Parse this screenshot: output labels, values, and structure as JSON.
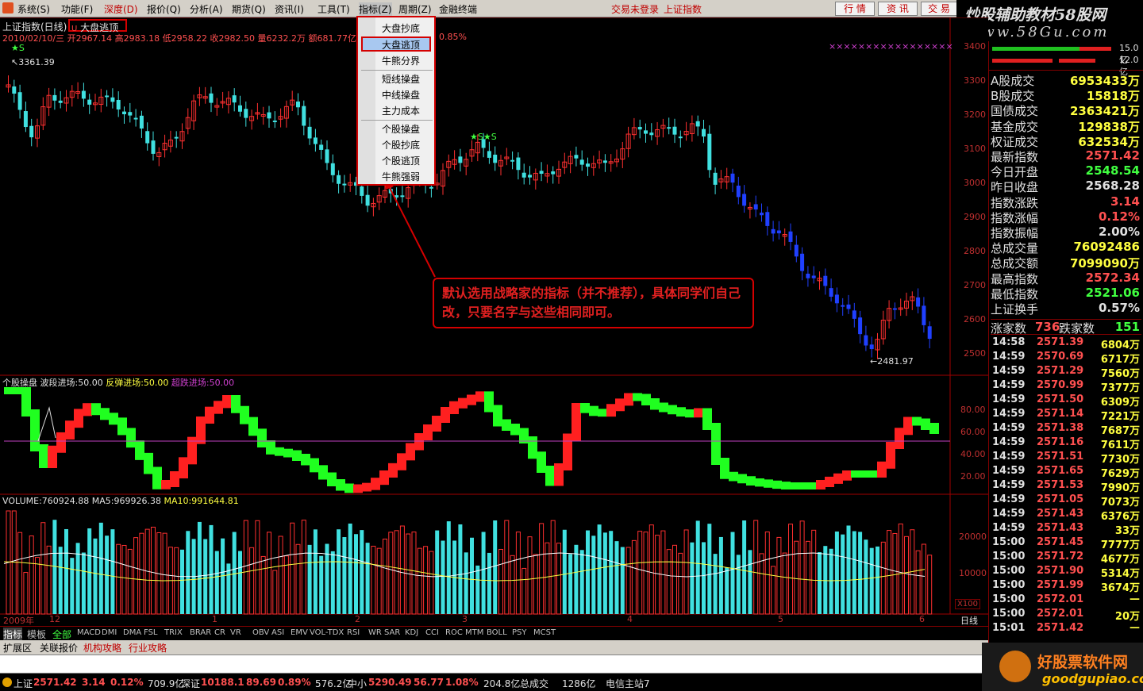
{
  "menu": {
    "items": [
      "系统(S)",
      "功能(F)",
      "深度(D)",
      "报价(Q)",
      "分析(A)",
      "期货(Q)",
      "资讯(I)",
      "工具(T)",
      "指标(Z)",
      "周期(Z)",
      "金融终端"
    ],
    "status": "交易未登录",
    "index_name": "上证指数",
    "right_buttons": [
      "行 情",
      "资 讯",
      "交 易"
    ]
  },
  "banner": {
    "title": "炒股辅助教材58股网",
    "url": "www.58Gu.com"
  },
  "dropdown": {
    "items": [
      "大盘抄底",
      "大盘逃顶",
      "牛熊分界",
      "短线操盘",
      "中线操盘",
      "主力成本",
      "个股操盘",
      "个股抄底",
      "个股逃顶",
      "牛熊强弱"
    ],
    "selected": "大盘逃顶"
  },
  "chart_header": {
    "title": "上证指数(日线)",
    "indicator": "大盘逃顶",
    "ohlc": "2010/02/10/三 开2967.14 高2983.18 低2958.22 收2982.50 量6232.2万 额681.77亿",
    "pct": "0.85%"
  },
  "annotation": "默认选用战略家的指标（并不推荐），具体同学们自己改，只要名字与这些相同即可。",
  "price_axis": [
    "3400",
    "3300",
    "3200",
    "3100",
    "3000",
    "2900",
    "2800",
    "2700",
    "2600",
    "2500"
  ],
  "price_marks": {
    "high": "3361.39",
    "low": "2481.97",
    "star1": "S",
    "star2": "S",
    "star3": "S"
  },
  "osc_header": {
    "name": "个股操盘",
    "a": "波段进场:50.00",
    "b": "反弹进场:50.00",
    "c": "超跌进场:50.00"
  },
  "osc_axis": [
    "80.00",
    "60.00",
    "40.00",
    "20.00"
  ],
  "vol_header": {
    "vol": "VOLUME:760924.88",
    "ma5": "MA5:969926.38",
    "ma10": "MA10:991644.81"
  },
  "vol_axis": [
    "20000",
    "10000"
  ],
  "vol_unit": "X100",
  "date_axis": {
    "year": "2009年",
    "labels": [
      "12",
      "1",
      "2",
      "3",
      "4",
      "5",
      "6"
    ],
    "right": "日线"
  },
  "tabs": [
    "指标",
    "模板",
    "全部",
    "MACD",
    "DMI",
    "DMA",
    "FSL",
    "TRIX",
    "BRAR",
    "CR",
    "VR",
    "OBV",
    "ASI",
    "EMV",
    "VOL-TDX",
    "RSI",
    "WR",
    "SAR",
    "KDJ",
    "CCI",
    "ROC",
    "MTM",
    "BOLL",
    "PSY",
    "MCST"
  ],
  "ext_tabs": [
    "扩展区",
    "关联报价",
    "机构攻略",
    "行业攻略"
  ],
  "right_panel": {
    "bar1": "15.0亿",
    "bar2": "12.0亿",
    "rows": [
      {
        "label": "A股成交",
        "value": "6953433万"
      },
      {
        "label": "B股成交",
        "value": "15818万"
      },
      {
        "label": "国债成交",
        "value": "2363421万"
      },
      {
        "label": "基金成交",
        "value": "129838万"
      },
      {
        "label": "权证成交",
        "value": "632534万"
      },
      {
        "label": "最新指数",
        "value": "2571.42"
      },
      {
        "label": "今日开盘",
        "value": "2548.54"
      },
      {
        "label": "昨日收盘",
        "value": "2568.28"
      },
      {
        "label": "指数涨跌",
        "value": "3.14"
      },
      {
        "label": "指数涨幅",
        "value": "0.12%"
      },
      {
        "label": "指数振幅",
        "value": "2.00%"
      },
      {
        "label": "总成交量",
        "value": "76092486"
      },
      {
        "label": "总成交额",
        "value": "7099090万"
      },
      {
        "label": "最高指数",
        "value": "2572.34"
      },
      {
        "label": "最低指数",
        "value": "2521.06"
      },
      {
        "label": "上证换手",
        "value": "0.57%"
      }
    ],
    "up_label": "涨家数",
    "up": "736",
    "down_label": "跌家数",
    "down": "151",
    "ticks": [
      [
        "14:58",
        "2571.39",
        "6804万"
      ],
      [
        "14:59",
        "2570.69",
        "6717万"
      ],
      [
        "14:59",
        "2571.29",
        "7560万"
      ],
      [
        "14:59",
        "2570.99",
        "7377万"
      ],
      [
        "14:59",
        "2571.50",
        "6309万"
      ],
      [
        "14:59",
        "2571.14",
        "7221万"
      ],
      [
        "14:59",
        "2571.38",
        "7687万"
      ],
      [
        "14:59",
        "2571.16",
        "7611万"
      ],
      [
        "14:59",
        "2571.51",
        "7730万"
      ],
      [
        "14:59",
        "2571.65",
        "7629万"
      ],
      [
        "14:59",
        "2571.53",
        "7990万"
      ],
      [
        "14:59",
        "2571.05",
        "7073万"
      ],
      [
        "14:59",
        "2571.43",
        "6376万"
      ],
      [
        "14:59",
        "2571.43",
        "33万"
      ],
      [
        "15:00",
        "2571.45",
        "7777万"
      ],
      [
        "15:00",
        "2571.72",
        "4677万"
      ],
      [
        "15:00",
        "2571.90",
        "5314万"
      ],
      [
        "15:00",
        "2571.99",
        "3674万"
      ],
      [
        "15:00",
        "2572.01",
        "—"
      ],
      [
        "15:00",
        "2572.01",
        "20万"
      ],
      [
        "15:01",
        "2571.42",
        "—"
      ]
    ]
  },
  "status": {
    "sh_label": "上证",
    "sh": "2571.42",
    "sh_chg": "3.14",
    "sh_pct": "0.12%",
    "sh_amt": "709.9亿",
    "sz_label": "深证",
    "sz": "10188.1",
    "sz_chg": "89.69",
    "sz_pct": "0.89%",
    "sz_amt": "576.2亿",
    "zx_label": "中小",
    "zx": "5290.49",
    "zx_chg": "56.77",
    "zx_pct": "1.08%",
    "zx_amt": "204.8亿",
    "total_label": "总成交",
    "total": "1286亿",
    "server": "电信主站7"
  },
  "logo2": {
    "title": "好股票软件网",
    "url": "goodgupiao.com"
  }
}
